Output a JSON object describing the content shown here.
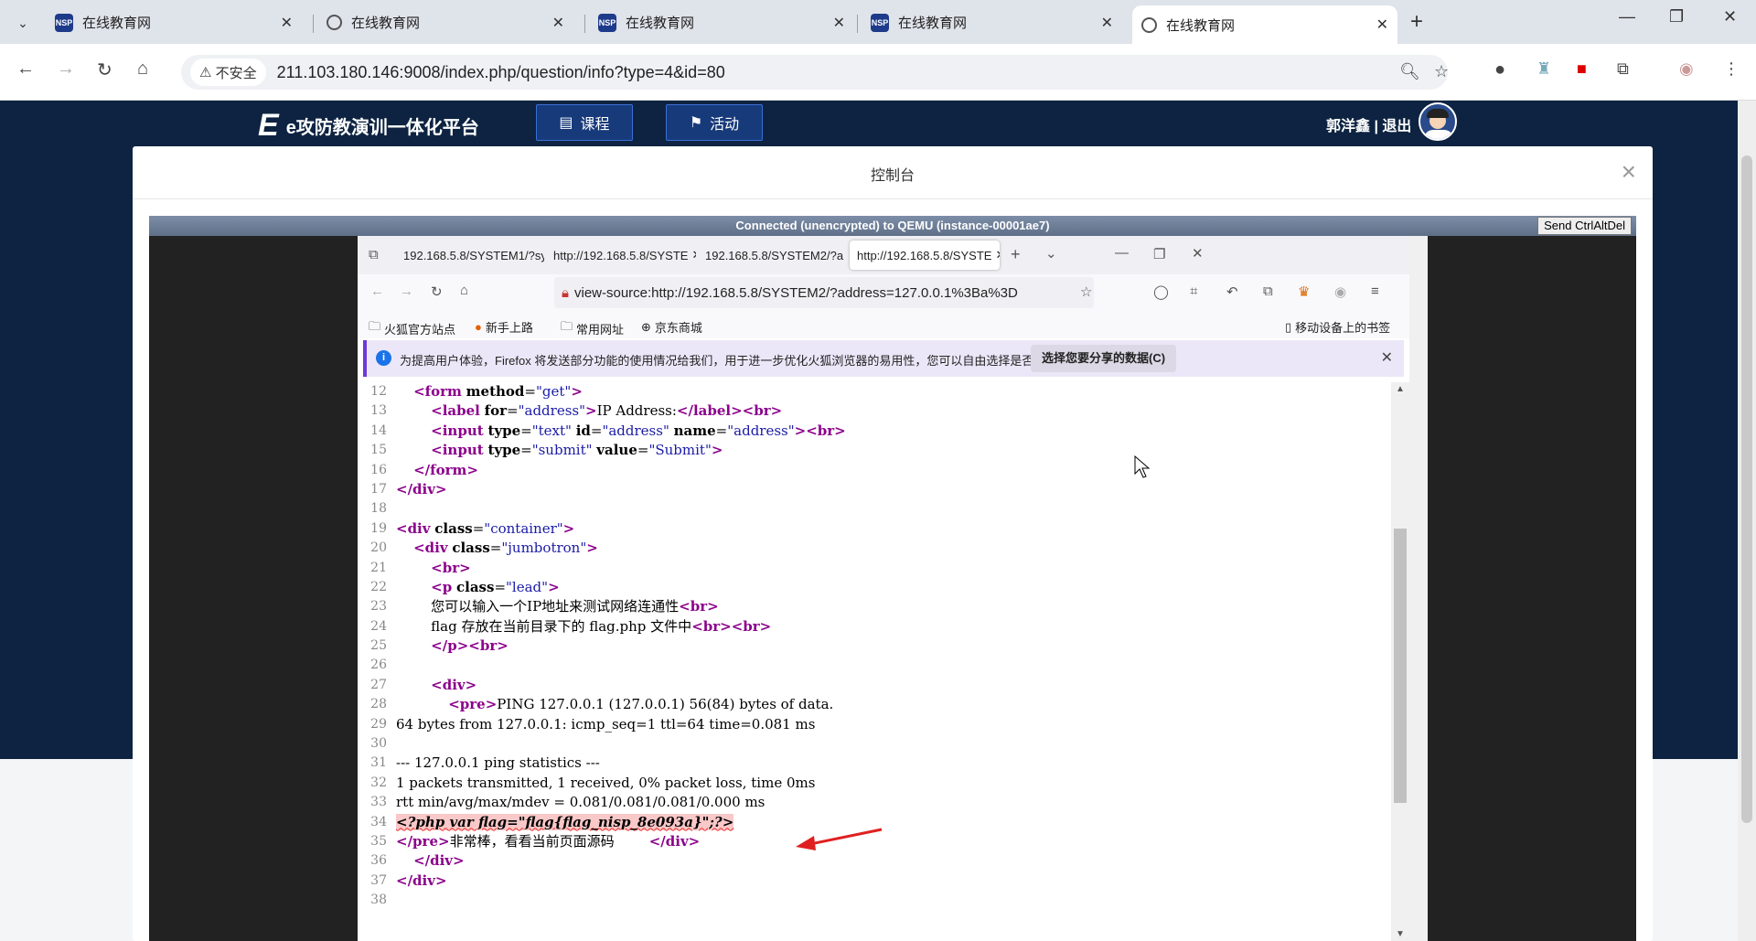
{
  "browser": {
    "tabs": [
      {
        "title": "在线教育网",
        "icon": "nsp-logo"
      },
      {
        "title": "在线教育网",
        "icon": "globe"
      },
      {
        "title": "在线教育网",
        "icon": "nsp-logo"
      },
      {
        "title": "在线教育网",
        "icon": "nsp-logo"
      },
      {
        "title": "在线教育网",
        "icon": "globe"
      }
    ],
    "security_label": "不安全",
    "url": "211.103.180.146:9008/index.php/question/info?type=4&id=80"
  },
  "site": {
    "brand_letter": "E",
    "brand": "e攻防教演训一体化平台",
    "nav": [
      {
        "label": "课程",
        "icon": "book-icon"
      },
      {
        "label": "活动",
        "icon": "flag-icon"
      }
    ],
    "user": "郭洋鑫 | 退出"
  },
  "modal": {
    "title": "控制台",
    "close": "×",
    "vnc_status": "Connected (unencrypted) to QEMU (instance-00001ae7)",
    "ctrl_alt_del": "Send CtrlAltDel"
  },
  "firefox": {
    "tabs": [
      {
        "title": "192.168.5.8/SYSTEM1/?sy"
      },
      {
        "title": "http://192.168.5.8/SYSTE"
      },
      {
        "title": "192.168.5.8/SYSTEM2/?a"
      },
      {
        "title": "http://192.168.5.8/SYSTE"
      }
    ],
    "url": "view-source:http://192.168.5.8/SYSTEM2/?address=127.0.0.1%3Ba%3D",
    "bookmarks": [
      "火狐官方站点",
      "新手上路",
      "常用网址",
      "京东商城"
    ],
    "mobile_bookmarks": "移动设备上的书签",
    "notice": "为提高用户体验，Firefox 将发送部分功能的使用情况给我们，用于进一步优化火狐浏览器的易用性，您可以自由选择是否向我们分享数据。",
    "notice_button": "选择您要分享的数据(C)"
  },
  "source_lines": [
    {
      "n": "12",
      "html": "    <span class=\"tg\">&lt;form</span> <span class=\"at\">method</span>=<span class=\"av\">\"get\"</span><span class=\"tg\">&gt;</span>"
    },
    {
      "n": "13",
      "html": "        <span class=\"tg\">&lt;label</span> <span class=\"at\">for</span>=<span class=\"av\">\"address\"</span><span class=\"tg\">&gt;</span>IP Address:<span class=\"tg\">&lt;/label&gt;&lt;br&gt;</span>"
    },
    {
      "n": "14",
      "html": "        <span class=\"tg\">&lt;input</span> <span class=\"at\">type</span>=<span class=\"av\">\"text\"</span> <span class=\"at\">id</span>=<span class=\"av\">\"address\"</span> <span class=\"at\">name</span>=<span class=\"av\">\"address\"</span><span class=\"tg\">&gt;&lt;br&gt;</span>"
    },
    {
      "n": "15",
      "html": "        <span class=\"tg\">&lt;input</span> <span class=\"at\">type</span>=<span class=\"av\">\"submit\"</span> <span class=\"at\">value</span>=<span class=\"av\">\"Submit\"</span><span class=\"tg\">&gt;</span>"
    },
    {
      "n": "16",
      "html": "    <span class=\"tg\">&lt;/form&gt;</span>"
    },
    {
      "n": "17",
      "html": "<span class=\"tg\">&lt;/div&gt;</span>"
    },
    {
      "n": "18",
      "html": ""
    },
    {
      "n": "19",
      "html": "<span class=\"tg\">&lt;div</span> <span class=\"at\">class</span>=<span class=\"av\">\"container\"</span><span class=\"tg\">&gt;</span>"
    },
    {
      "n": "20",
      "html": "    <span class=\"tg\">&lt;div</span> <span class=\"at\">class</span>=<span class=\"av\">\"jumbotron\"</span><span class=\"tg\">&gt;</span>"
    },
    {
      "n": "21",
      "html": "        <span class=\"tg\">&lt;br&gt;</span>"
    },
    {
      "n": "22",
      "html": "        <span class=\"tg\">&lt;p</span> <span class=\"at\">class</span>=<span class=\"av\">\"lead\"</span><span class=\"tg\">&gt;</span>"
    },
    {
      "n": "23",
      "html": "        您可以输入一个IP地址来测试网络连通性<span class=\"tg\">&lt;br&gt;</span>"
    },
    {
      "n": "24",
      "html": "        flag 存放在当前目录下的 flag.php 文件中<span class=\"tg\">&lt;br&gt;&lt;br&gt;</span>"
    },
    {
      "n": "25",
      "html": "        <span class=\"tg\">&lt;/p&gt;&lt;br&gt;</span>"
    },
    {
      "n": "26",
      "html": ""
    },
    {
      "n": "27",
      "html": "        <span class=\"tg\">&lt;div&gt;</span>"
    },
    {
      "n": "28",
      "html": "            <span class=\"tg\">&lt;pre&gt;</span>PING 127.0.0.1 (127.0.0.1) 56(84) bytes of data."
    },
    {
      "n": "29",
      "html": "64 bytes from 127.0.0.1: icmp_seq=1 ttl=64 time=0.081 ms"
    },
    {
      "n": "30",
      "html": ""
    },
    {
      "n": "31",
      "html": "--- 127.0.0.1 ping statistics ---"
    },
    {
      "n": "32",
      "html": "1 packets transmitted, 1 received, 0% packet loss, time 0ms"
    },
    {
      "n": "33",
      "html": "rtt min/avg/max/mdev = 0.081/0.081/0.081/0.000 ms"
    },
    {
      "n": "34",
      "html": "<span class=\"hl\">&lt;?php var flag=\"flag{flag_nisp_8e093a}\";?&gt;</span>"
    },
    {
      "n": "35",
      "html": "<span class=\"tg\">&lt;/pre&gt;</span>非常棒，看看当前页面源码        <span class=\"tg\">&lt;/div&gt;</span>"
    },
    {
      "n": "36",
      "html": "    <span class=\"tg\">&lt;/div&gt;</span>"
    },
    {
      "n": "37",
      "html": "<span class=\"tg\">&lt;/div&gt;</span>"
    },
    {
      "n": "38",
      "html": ""
    }
  ],
  "colors": {
    "site_bg": "#0d2341",
    "accent": "#3b6fd8",
    "annotation": "#e02020"
  }
}
